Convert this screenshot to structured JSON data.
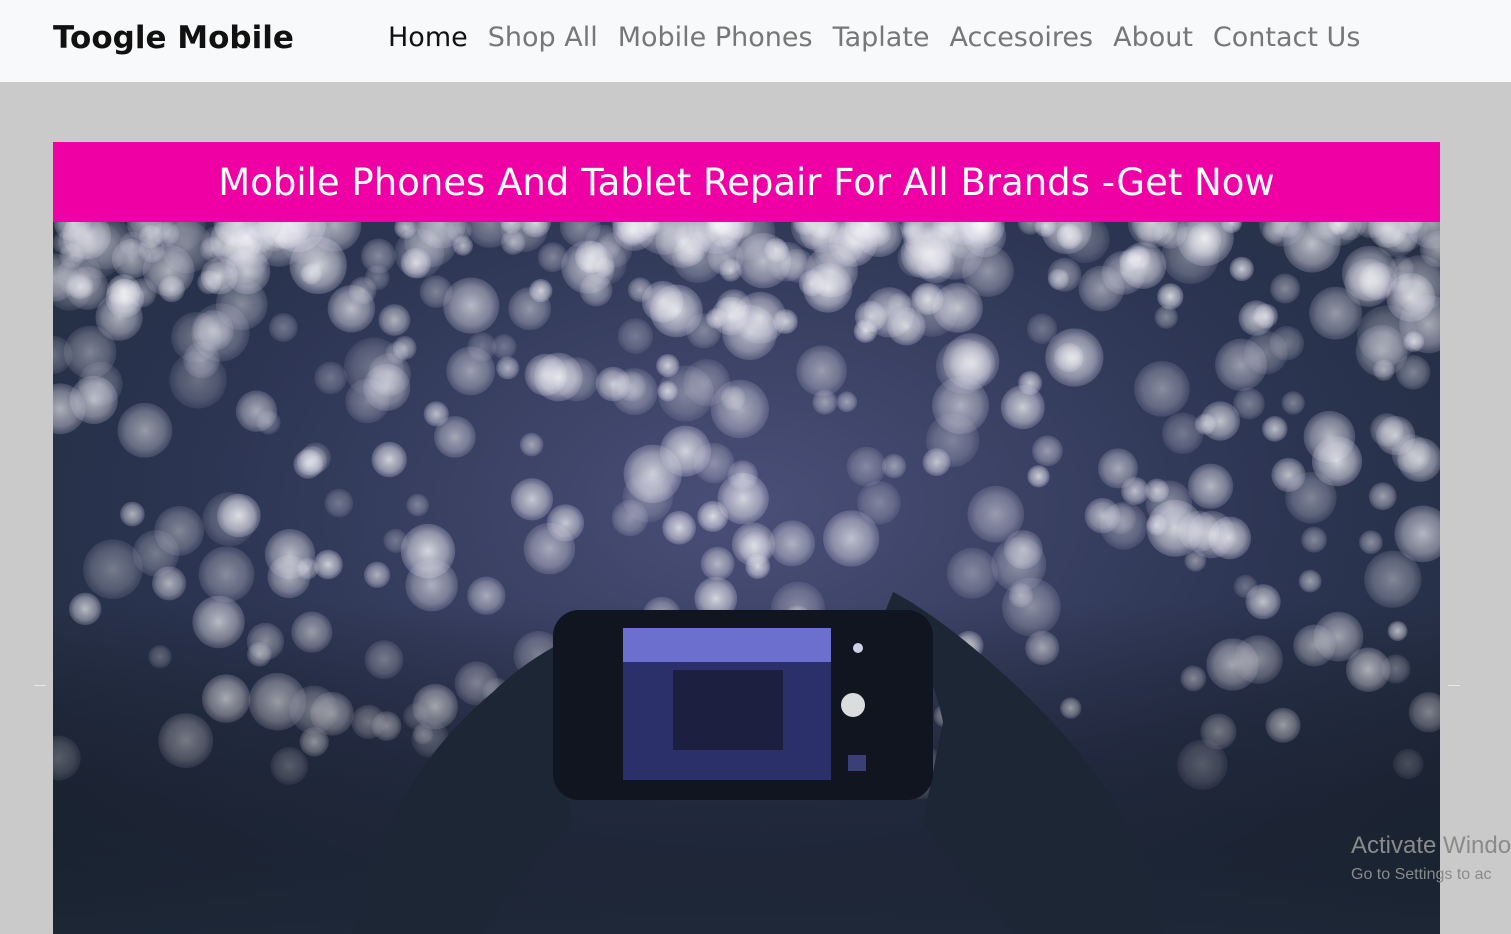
{
  "navbar": {
    "brand": "Toogle Mobile",
    "links": [
      {
        "label": "Home",
        "active": true
      },
      {
        "label": "Shop All",
        "active": false
      },
      {
        "label": "Mobile Phones",
        "active": false
      },
      {
        "label": "Taplate",
        "active": false
      },
      {
        "label": "Accesoires",
        "active": false
      },
      {
        "label": "About",
        "active": false
      },
      {
        "label": "Contact Us",
        "active": false
      }
    ]
  },
  "banner": {
    "text": "Mobile Phones And Tablet Repair For All Brands -Get Now",
    "background": "#ee00a4",
    "color": "#ffffff"
  },
  "hero": {
    "image": "bokeh-lights-phone-photo"
  },
  "watermark": {
    "title": "Activate Windo",
    "subtitle": "Go to Settings to ac"
  },
  "colors": {
    "page_background": "#cacaca",
    "navbar_background": "#f8f9fa",
    "nav_active": "#111111",
    "nav_inactive": "#777777"
  }
}
